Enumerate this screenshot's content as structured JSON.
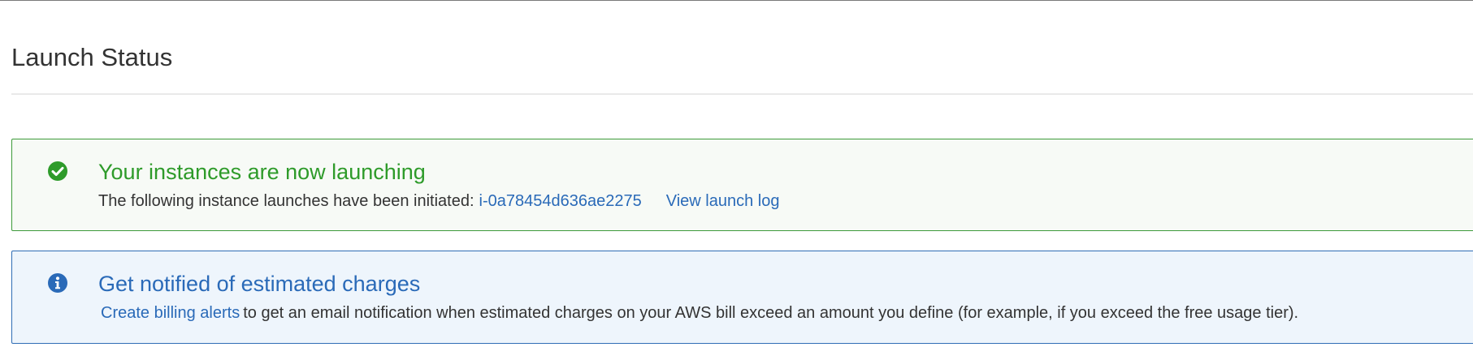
{
  "page": {
    "title": "Launch Status"
  },
  "success_alert": {
    "heading": "Your instances are now launching",
    "message": "The following instance launches have been initiated:",
    "instance_id": "i-0a78454d636ae2275",
    "view_log_label": "View launch log",
    "icon": "check-circle-icon",
    "color": "#2e9b2a"
  },
  "info_alert": {
    "heading": "Get notified of estimated charges",
    "link_label": "Create billing alerts",
    "message": "to get an email notification when estimated charges on your AWS bill exceed an amount you define (for example, if you exceed the free usage tier).",
    "icon": "info-circle-icon",
    "color": "#2a6ab8"
  }
}
